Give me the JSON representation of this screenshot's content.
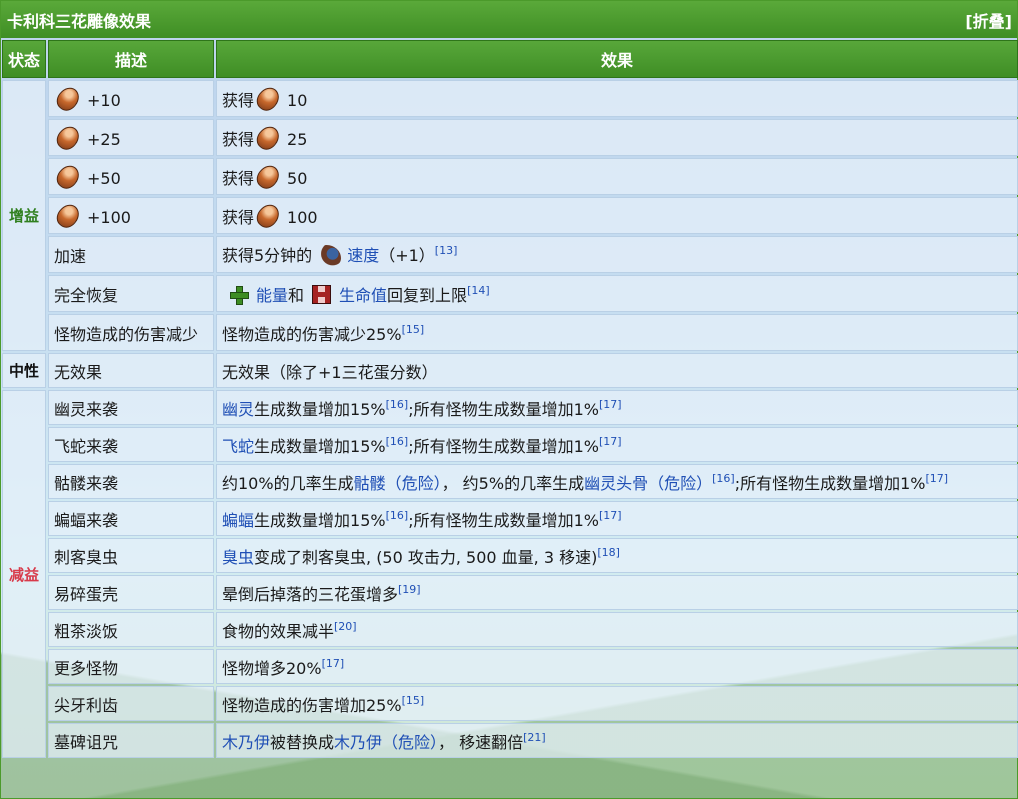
{
  "caption": {
    "title": "卡利科三花雕像效果",
    "toggle": "[折叠]"
  },
  "headers": {
    "status": "状态",
    "desc": "描述",
    "effect": "效果"
  },
  "groups": {
    "buff": "增益",
    "neutral": "中性",
    "debuff": "减益"
  },
  "rows": {
    "r1": {
      "desc": "+10",
      "get": "获得",
      "amount": "10"
    },
    "r2": {
      "desc": "+25",
      "get": "获得",
      "amount": "25"
    },
    "r3": {
      "desc": "+50",
      "get": "获得",
      "amount": "50"
    },
    "r4": {
      "desc": "+100",
      "get": "获得",
      "amount": "100"
    },
    "speed": {
      "desc": "加速",
      "pre": "获得5分钟的",
      "link": "速度",
      "post": "（+1）",
      "ref": "[13]"
    },
    "heal": {
      "desc": "完全恢复",
      "link1": "能量",
      "mid": "和",
      "link2": "生命值",
      "post": "回复到上限",
      "ref": "[14]"
    },
    "dmgdown": {
      "desc": "怪物造成的伤害减少",
      "text": "怪物造成的伤害减少25%",
      "ref": "[15]"
    },
    "none": {
      "desc": "无效果",
      "text": "无效果（除了+1三花蛋分数）"
    },
    "ghost": {
      "desc": "幽灵来袭",
      "link": "幽灵",
      "text": "生成数量增加15%",
      "ref1": "[16]",
      "text2": ";所有怪物生成数量增加1%",
      "ref2": "[17]"
    },
    "serpent": {
      "desc": "飞蛇来袭",
      "link": "飞蛇",
      "text": "生成数量增加15%",
      "ref1": "[16]",
      "text2": ";所有怪物生成数量增加1%",
      "ref2": "[17]"
    },
    "skeleton": {
      "desc": "骷髅来袭",
      "pre": "约10%的几率生成",
      "link1": "骷髅（危险）",
      "mid": "， 约5%的几率生成",
      "link2": "幽灵头骨（危险）",
      "ref1": "[16]",
      "text2": ";所有怪物生成数量增加1%",
      "ref2": "[17]"
    },
    "bat": {
      "desc": "蝙蝠来袭",
      "link": "蝙蝠",
      "text": "生成数量增加15%",
      "ref1": "[16]",
      "text2": ";所有怪物生成数量增加1%",
      "ref2": "[17]"
    },
    "bug": {
      "desc": "刺客臭虫",
      "link": "臭虫",
      "text": "变成了刺客臭虫, (50 攻击力, 500 血量, 3 移速)",
      "ref": "[18]"
    },
    "egg": {
      "desc": "易碎蛋壳",
      "text": "晕倒后掉落的三花蛋增多",
      "ref": "[19]"
    },
    "food": {
      "desc": "粗茶淡饭",
      "text": "食物的效果减半",
      "ref": "[20]"
    },
    "monsters": {
      "desc": "更多怪物",
      "text": "怪物增多20%",
      "ref": "[17]"
    },
    "teeth": {
      "desc": "尖牙利齿",
      "text": "怪物造成的伤害增加25%",
      "ref": "[15]"
    },
    "curse": {
      "desc": "墓碑诅咒",
      "link1": "木乃伊",
      "mid": "被替换成",
      "link2": "木乃伊（危险）",
      "post": "， 移速翻倍",
      "ref": "[21]"
    }
  },
  "icons": {
    "egg": "calico-egg-icon",
    "energy": "energy-plus-icon",
    "health": "health-icon",
    "speed": "speed-icon"
  },
  "colors": {
    "header_green": "#4a9b2f",
    "buff_green": "#2f7f1e",
    "debuff_red": "#d83a4a",
    "link_blue": "#1f4fb5"
  }
}
